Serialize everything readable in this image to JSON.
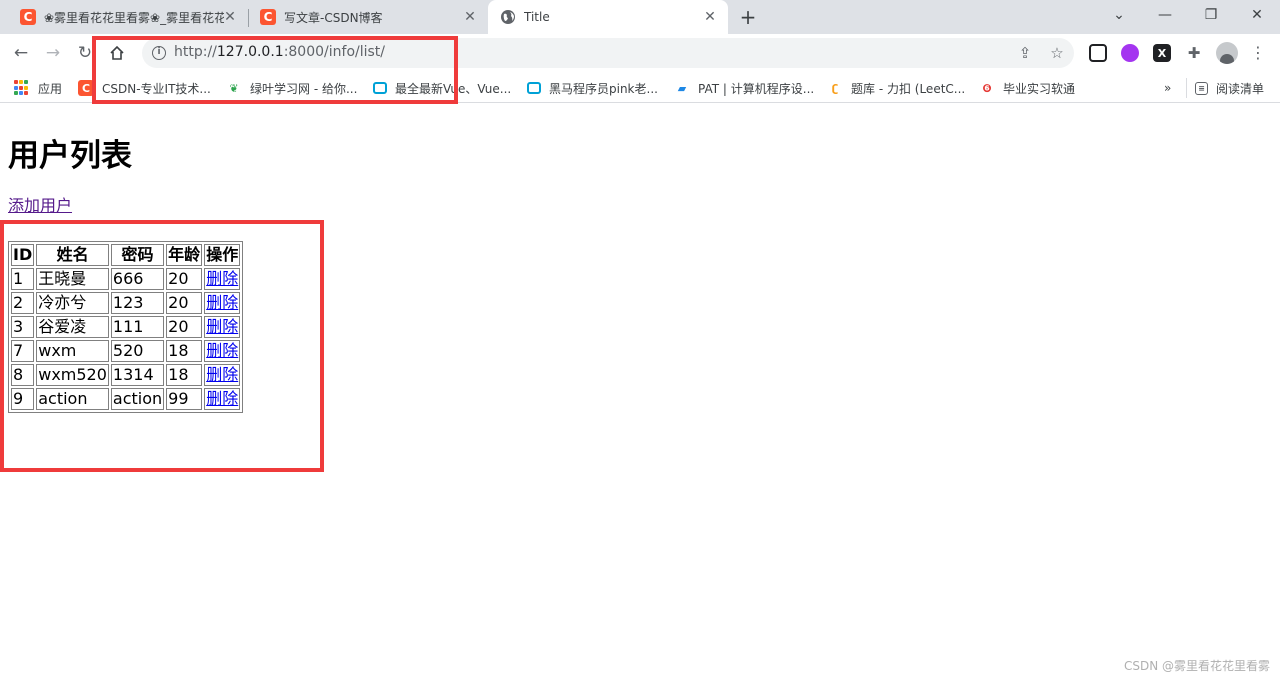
{
  "tabs": [
    {
      "title": "❀雾里看花花里看雾❀_雾里看花花里看雾",
      "favicon": "C",
      "active": false
    },
    {
      "title": "写文章-CSDN博客",
      "favicon": "C",
      "active": false
    },
    {
      "title": "Title",
      "favicon": "globe-icon",
      "active": true
    }
  ],
  "toolbar": {
    "url_scheme": "http://",
    "url_host": "127.0.0.1",
    "url_rest": ":8000/info/list/"
  },
  "bookmarks": [
    {
      "label": "应用"
    },
    {
      "label": "CSDN-专业IT技术..."
    },
    {
      "label": "绿叶学习网 - 给你..."
    },
    {
      "label": "最全最新Vue、Vue..."
    },
    {
      "label": "黑马程序员pink老..."
    },
    {
      "label": "PAT | 计算机程序设..."
    },
    {
      "label": "题库 - 力扣 (LeetC..."
    },
    {
      "label": "毕业实习软通"
    }
  ],
  "bookmarks_more": "»",
  "reading_list": "阅读清单",
  "page": {
    "title": "用户列表",
    "add_link": "添加用户",
    "table": {
      "headers": [
        "ID",
        "姓名",
        "密码",
        "年龄",
        "操作"
      ],
      "rows": [
        {
          "id": "1",
          "name": "王晓曼",
          "password": "666",
          "age": "20",
          "action": "删除"
        },
        {
          "id": "2",
          "name": "冷亦兮",
          "password": "123",
          "age": "20",
          "action": "删除"
        },
        {
          "id": "3",
          "name": "谷爱凌",
          "password": "111",
          "age": "20",
          "action": "删除"
        },
        {
          "id": "7",
          "name": "wxm",
          "password": "520",
          "age": "18",
          "action": "删除"
        },
        {
          "id": "8",
          "name": "wxm520",
          "password": "1314",
          "age": "18",
          "action": "删除"
        },
        {
          "id": "9",
          "name": "action",
          "password": "action",
          "age": "99",
          "action": "删除"
        }
      ]
    }
  },
  "watermark": "CSDN @雾里看花花里看雾",
  "colors": {
    "highlight": "#ef3b3b",
    "csdn_brand": "#fc5531",
    "link": "#0000ee",
    "visited_link": "#551a8b"
  }
}
